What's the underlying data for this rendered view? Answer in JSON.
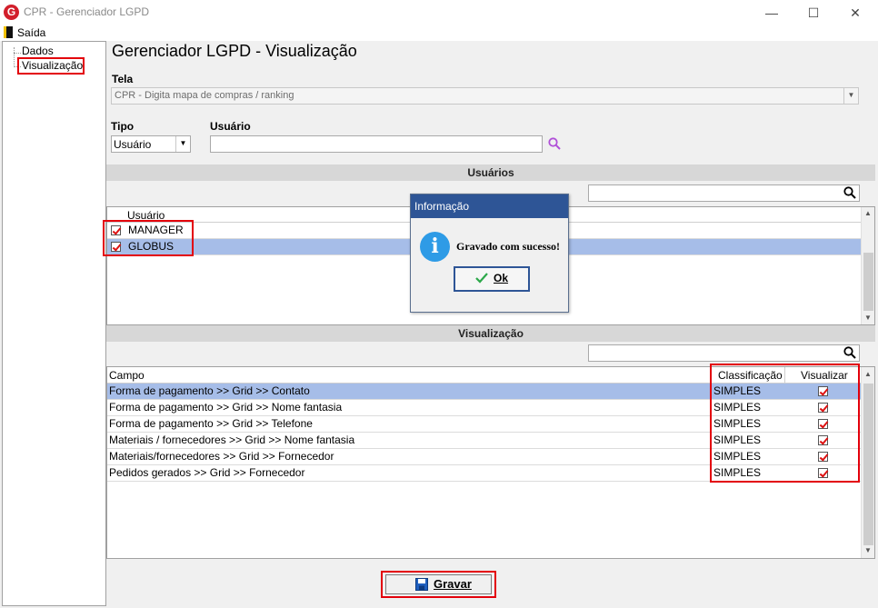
{
  "window": {
    "title": "CPR - Gerenciador LGPD",
    "logo": "G",
    "minimize_glyph": "—",
    "maximize_glyph": "☐",
    "close_glyph": "✕"
  },
  "menu": {
    "exit_label": "Saída"
  },
  "tree": {
    "items": [
      "Dados",
      "Visualização"
    ]
  },
  "page": {
    "title": "Gerenciador LGPD - Visualização"
  },
  "tela": {
    "label": "Tela",
    "value": "CPR - Digita mapa de compras / ranking"
  },
  "tipo": {
    "label": "Tipo",
    "value": "Usuário"
  },
  "usuario": {
    "label": "Usuário",
    "value": ""
  },
  "usuarios_section": {
    "title": "Usuários",
    "column": "Usuário",
    "rows": [
      {
        "name": "MANAGER",
        "checked": true
      },
      {
        "name": "GLOBUS",
        "checked": true
      }
    ]
  },
  "visualizacao_section": {
    "title": "Visualização",
    "columns": [
      "Campo",
      "Classificação",
      "Visualizar"
    ],
    "rows": [
      {
        "campo": "Forma de pagamento >> Grid >> Contato",
        "classificacao": "SIMPLES",
        "visualizar": true
      },
      {
        "campo": "Forma de pagamento >> Grid >> Nome fantasia",
        "classificacao": "SIMPLES",
        "visualizar": true
      },
      {
        "campo": "Forma de pagamento >> Grid >> Telefone",
        "classificacao": "SIMPLES",
        "visualizar": true
      },
      {
        "campo": "Materiais / fornecedores >> Grid >> Nome fantasia",
        "classificacao": "SIMPLES",
        "visualizar": true
      },
      {
        "campo": "Materiais/fornecedores >> Grid >> Fornecedor",
        "classificacao": "SIMPLES",
        "visualizar": true
      },
      {
        "campo": "Pedidos gerados >> Grid >> Fornecedor",
        "classificacao": "SIMPLES",
        "visualizar": true
      }
    ]
  },
  "dialog": {
    "title": "Informação",
    "message": "Gravado com sucesso!",
    "ok_label": "Ok",
    "icon": "info-icon"
  },
  "footer": {
    "save_label": "Gravar"
  },
  "colors": {
    "highlight": "#e3000b",
    "selection": "#a6bde8",
    "dialog_title": "#2e5596"
  }
}
